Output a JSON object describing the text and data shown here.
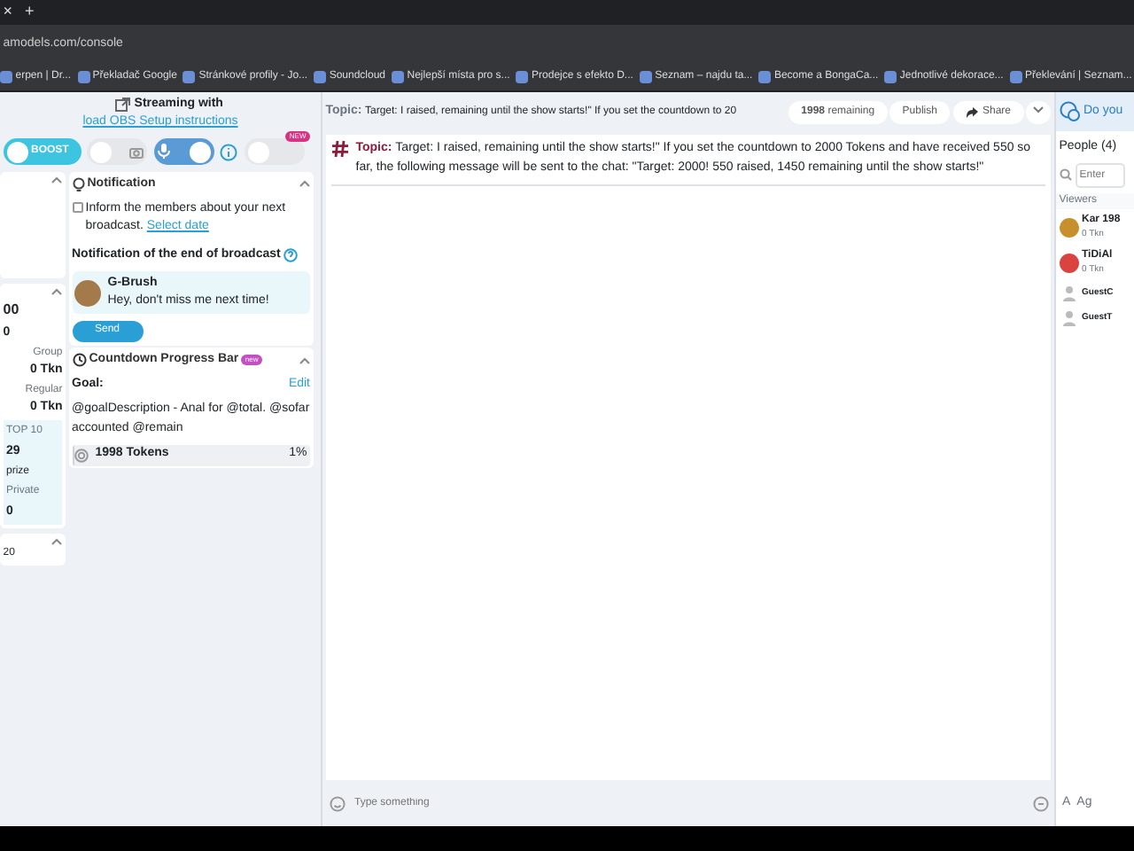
{
  "browser": {
    "close_tab": "×",
    "new_tab": "+",
    "address": "amodels.com/console",
    "bookmarks": [
      "erpen | Dr...",
      "Překladač Google",
      "Stránkové profily - Jo...",
      "Soundcloud",
      "Nejlepší místa pro s...",
      "Prodejce s efekto D...",
      "Seznam – najdu ta...",
      "Become a BongaCa...",
      "Jednotlivé dekorace...",
      "Překlevání | Seznam..."
    ]
  },
  "stream_header": {
    "label": "Streaming with",
    "link": "load OBS Setup instructions"
  },
  "toggles": [
    {
      "kind": "boost",
      "label": "BOOST",
      "on": true
    },
    {
      "kind": "camera",
      "on": false
    },
    {
      "kind": "mic",
      "on": true
    },
    {
      "kind": "info"
    },
    {
      "kind": "extra",
      "on": false,
      "badge": "NEW"
    }
  ],
  "stats_panel": {
    "top_value": "00",
    "second_value": "0",
    "stats": [
      {
        "label": "Group",
        "value": "0 Tkn"
      },
      {
        "label": "Regular",
        "value": "0 Tkn"
      }
    ],
    "top_box": {
      "caption": "TOP 10",
      "value": "29",
      "tag": "prize",
      "private_label": "Private",
      "private_value": "0"
    },
    "footer": "20"
  },
  "notification": {
    "title": "Notification",
    "checked": false,
    "text": "Inform the members about your next broadcast.",
    "link": "Select date",
    "end_title": "Notification of the end of broadcast",
    "sender": "G-Brush",
    "message": "Hey, don't miss me next time!",
    "send": "Send"
  },
  "countdown": {
    "title": "Countdown Progress Bar",
    "badge": "new",
    "goal_label": "Goal:",
    "edit": "Edit",
    "description": "@goalDescription - Anal for @total. @sofar accounted @remain",
    "tokens": "1998 Tokens",
    "percent": "1%",
    "level": 0.01
  },
  "topic_bar": {
    "label": "Topic:",
    "value": "Target: I raised, remaining until the show starts!\" If you set the countdown to 20",
    "remaining_count": "1998",
    "remaining_label": "remaining",
    "publish": "Publish",
    "share": "Share"
  },
  "chat": {
    "messages": [
      {
        "label": "Topic:",
        "text": "Target: I raised, remaining until the show starts!\" If you set the countdown to 2000 Tokens and have received 550 so far, the following message will be sent to the chat: \"Target: 2000! 550 raised, 1450 remaining until the show starts!\""
      }
    ],
    "placeholder": "Type something"
  },
  "people": {
    "header": "Do you",
    "title": "People (4)",
    "search_placeholder": "Enter",
    "section": "Viewers",
    "users": [
      {
        "kind": "member",
        "name": "Kar 198",
        "sub": "0 Tkn",
        "color": "#c8902c"
      },
      {
        "kind": "member",
        "name": "TiDiAl",
        "sub": "0 Tkn",
        "color": "#d9443f"
      },
      {
        "kind": "guest",
        "name": "GuestC"
      },
      {
        "kind": "guest",
        "name": "GuestT"
      }
    ],
    "footer_icons": [
      "A",
      "Ag"
    ]
  }
}
